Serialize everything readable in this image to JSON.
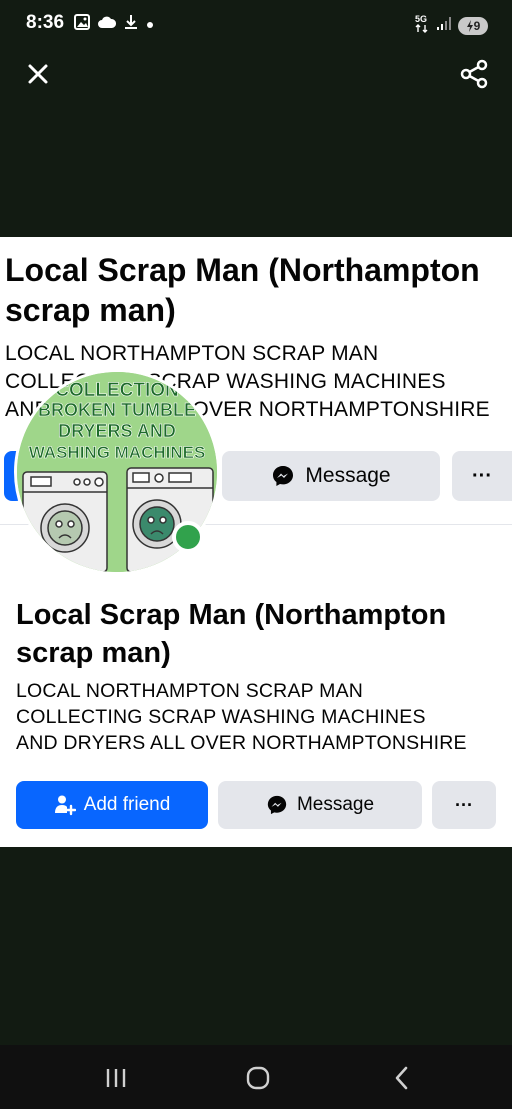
{
  "status_bar": {
    "time": "8:36",
    "network": "5G",
    "battery": "9",
    "left_icons": [
      "image-icon",
      "cloud-icon",
      "download-icon",
      "dot-icon"
    ],
    "right_icons": [
      "5g-icon",
      "signal-icon",
      "battery-icon"
    ]
  },
  "top_actions": {
    "close_icon": "close-icon",
    "share_icon": "share-icon"
  },
  "profile_back": {
    "name": "Local Scrap Man (Northampton scrap man)",
    "bio_line1": "LOCAL NORTHAMPTON SCRAP MAN",
    "bio_line2": "COLLECTING SCRAP WASHING MACHINES",
    "bio_line3": "AND DRYERS ALL OVER NORTHAMPTONSHIRE",
    "message_label": "Message",
    "more_label": "···"
  },
  "avatar": {
    "text_line1": "COLLECTION",
    "text_line2": "BROKEN TUMBLE",
    "text_line3": "DRYERS AND",
    "text_line4": "WASHING MACHINES",
    "online": true,
    "bg_color": "#9fd68a",
    "text_color": "#1d6b2a"
  },
  "profile_front": {
    "name": "Local Scrap Man (Northampton scrap man)",
    "bio_line1": "LOCAL NORTHAMPTON SCRAP MAN",
    "bio_line2": "COLLECTING SCRAP WASHING MACHINES",
    "bio_line3": "AND DRYERS ALL OVER NORTHAMPTONSHIRE",
    "add_friend_label": "Add friend",
    "message_label": "Message",
    "more_label": "···"
  },
  "nav_bar": {
    "icons": [
      "recent-apps-icon",
      "home-icon",
      "back-icon"
    ]
  },
  "colors": {
    "background": "#121b12",
    "primary": "#0866ff",
    "secondary_button": "#e4e6eb",
    "online": "#31a24c"
  }
}
